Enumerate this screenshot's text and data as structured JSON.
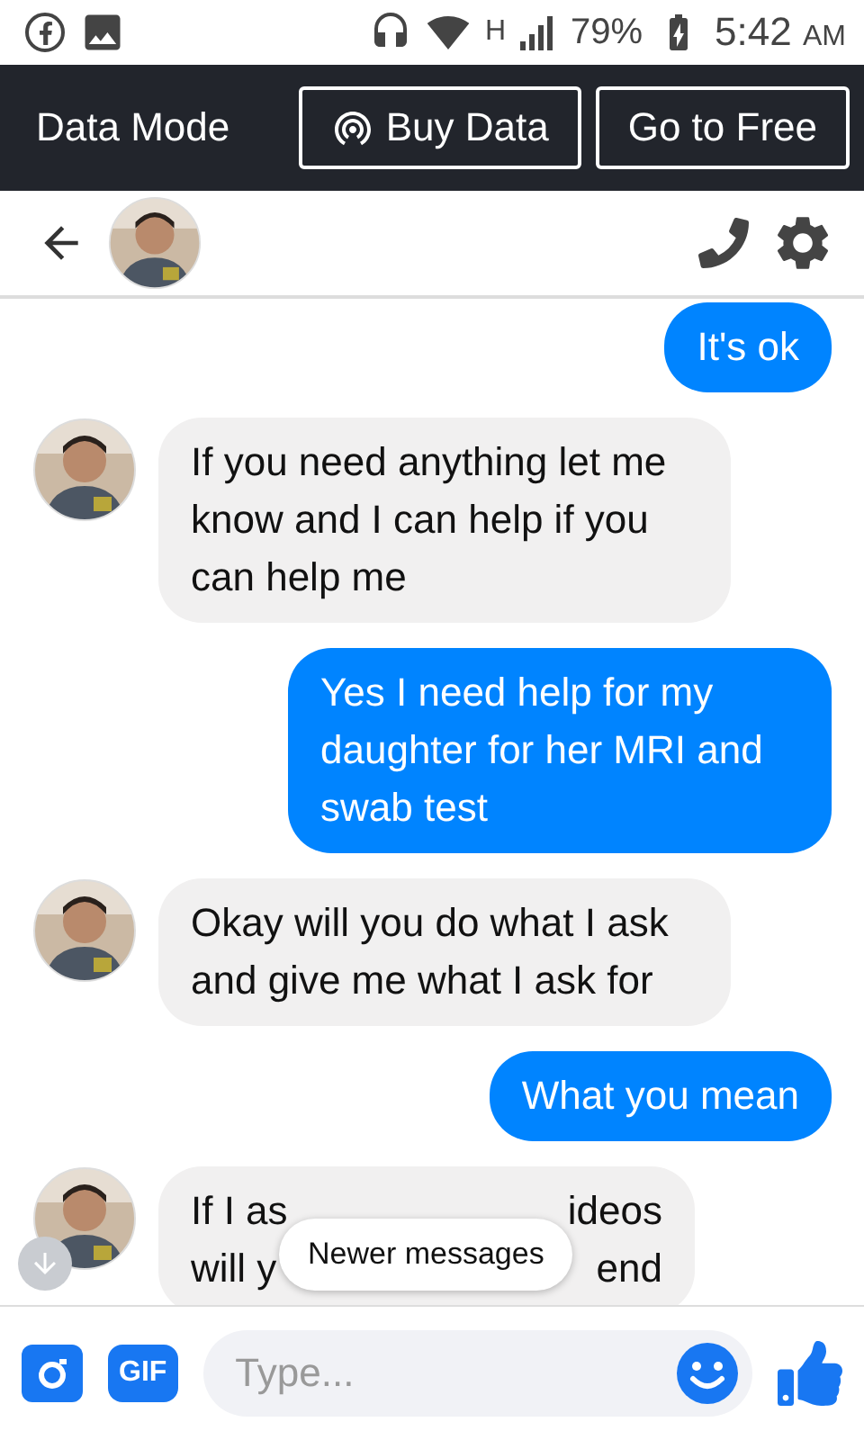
{
  "status_bar": {
    "network": "H",
    "battery": "79%",
    "time": "5:42",
    "meridiem": "AM"
  },
  "data_bar": {
    "label": "Data Mode",
    "buttons": [
      {
        "label": "Buy Data",
        "kind": "buy"
      },
      {
        "label": "Go to Free",
        "kind": "plain"
      }
    ]
  },
  "messages": [
    {
      "kind": "sent",
      "text": "It's ok"
    },
    {
      "kind": "received",
      "text": "If you need anything let me know and I can help if you can help me"
    },
    {
      "kind": "sent",
      "text": "Yes I need help for my daughter for her MRI and swab test"
    },
    {
      "kind": "received",
      "text": "Okay will you do what I ask and give me what I ask for"
    },
    {
      "kind": "sent",
      "text": "What you mean"
    },
    {
      "kind": "received",
      "fragments": [
        [
          "If I as",
          "ideos"
        ],
        [
          "will y",
          "end"
        ]
      ]
    }
  ],
  "newer_messages": "Newer messages",
  "composer": {
    "gif": "GIF",
    "placeholder": "Type..."
  }
}
